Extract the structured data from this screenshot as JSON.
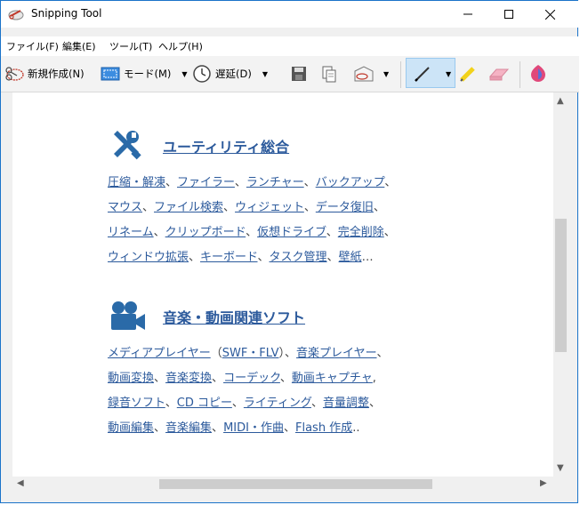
{
  "window": {
    "title": "Snipping Tool"
  },
  "menu": [
    {
      "label": "ファイル(F)"
    },
    {
      "label": "編集(E)"
    },
    {
      "label": "ツール(T)"
    },
    {
      "label": "ヘルプ(H)"
    }
  ],
  "toolbar": {
    "new_label": "新規作成(N)",
    "mode_label": "モード(M)",
    "delay_label": "遅延(D)"
  },
  "sections": [
    {
      "title": "ユーティリティ総合",
      "icon": "tools-icon",
      "lines": [
        [
          "圧縮・解凍",
          "ファイラー",
          "ランチャー",
          "バックアップ"
        ],
        [
          "マウス",
          "ファイル検索",
          "ウィジェット",
          "データ復旧"
        ],
        [
          "リネーム",
          "クリップボード",
          "仮想ドライブ",
          "完全削除"
        ],
        [
          "ウィンドウ拡張",
          "キーボード",
          "タスク管理",
          "壁紙"
        ]
      ]
    },
    {
      "title": "音楽・動画関連ソフト",
      "icon": "video-camera-icon",
      "lines": [
        [
          "メディアプレイヤー",
          "SWF・FLV",
          "音楽プレイヤー"
        ],
        [
          "動画変換",
          "音楽変換",
          "コーデック",
          "動画キャプチャ"
        ],
        [
          "録音ソフト",
          "CD コピー",
          "ライティング",
          "音量調整"
        ],
        [
          "動画編集",
          "音楽編集",
          "MIDI・作曲",
          "Flash 作成"
        ]
      ]
    }
  ],
  "text": {
    "comma": "、",
    "ellipsis": "…",
    "paren_open": "（",
    "paren_close": "）",
    "comma_ascii": ",",
    "dots": ".."
  },
  "colors": {
    "link": "#2c5a9c",
    "icon_blue": "#2a6aa8",
    "accent_border": "#1a73c9"
  }
}
